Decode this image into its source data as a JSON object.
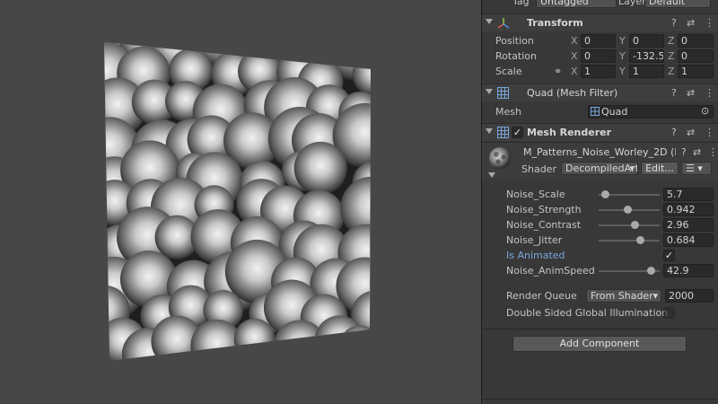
{
  "top": {
    "tag_label": "Tag",
    "tag_value": "Untagged",
    "layer_label": "Layer",
    "layer_value": "Default"
  },
  "transform": {
    "title": "Transform",
    "position_label": "Position",
    "rotation_label": "Rotation",
    "scale_label": "Scale",
    "axis_x": "X",
    "axis_y": "Y",
    "axis_z": "Z",
    "position": [
      "0",
      "0",
      "0"
    ],
    "rotation": [
      "0",
      "-132.5:",
      "0"
    ],
    "scale": [
      "1",
      "1",
      "1"
    ]
  },
  "mesh_filter": {
    "title": "Quad (Mesh Filter)",
    "mesh_label": "Mesh",
    "mesh_value": "Quad"
  },
  "mesh_renderer": {
    "title": "Mesh Renderer"
  },
  "material": {
    "name": "M_Patterns_Noise_Worley_2D (M",
    "shader_label": "Shader",
    "shader_value": "DecompiledArt",
    "edit_label": "Edit..."
  },
  "properties": [
    {
      "label": "Noise_Scale",
      "value": "5.7",
      "fraction": 0.11
    },
    {
      "label": "Noise_Strength",
      "value": "0.942",
      "fraction": 0.47
    },
    {
      "label": "Noise_Contrast",
      "value": "2.96",
      "fraction": 0.59
    },
    {
      "label": "Noise_Jitter",
      "value": "0.684",
      "fraction": 0.68
    },
    {
      "label": "Is Animated",
      "checked": true
    },
    {
      "label": "Noise_AnimSpeed",
      "value": "42.9",
      "fraction": 0.86
    }
  ],
  "render_queue": {
    "label": "Render Queue",
    "mode": "From Shader",
    "value": "2000"
  },
  "double_sided": {
    "label": "Double Sided Global Illumination",
    "checked": false
  },
  "add_component_label": "Add Component",
  "colors": {
    "scene_bg": "#474747",
    "inspector_bg": "#383838",
    "highlight_label": "#7aa6dd"
  }
}
